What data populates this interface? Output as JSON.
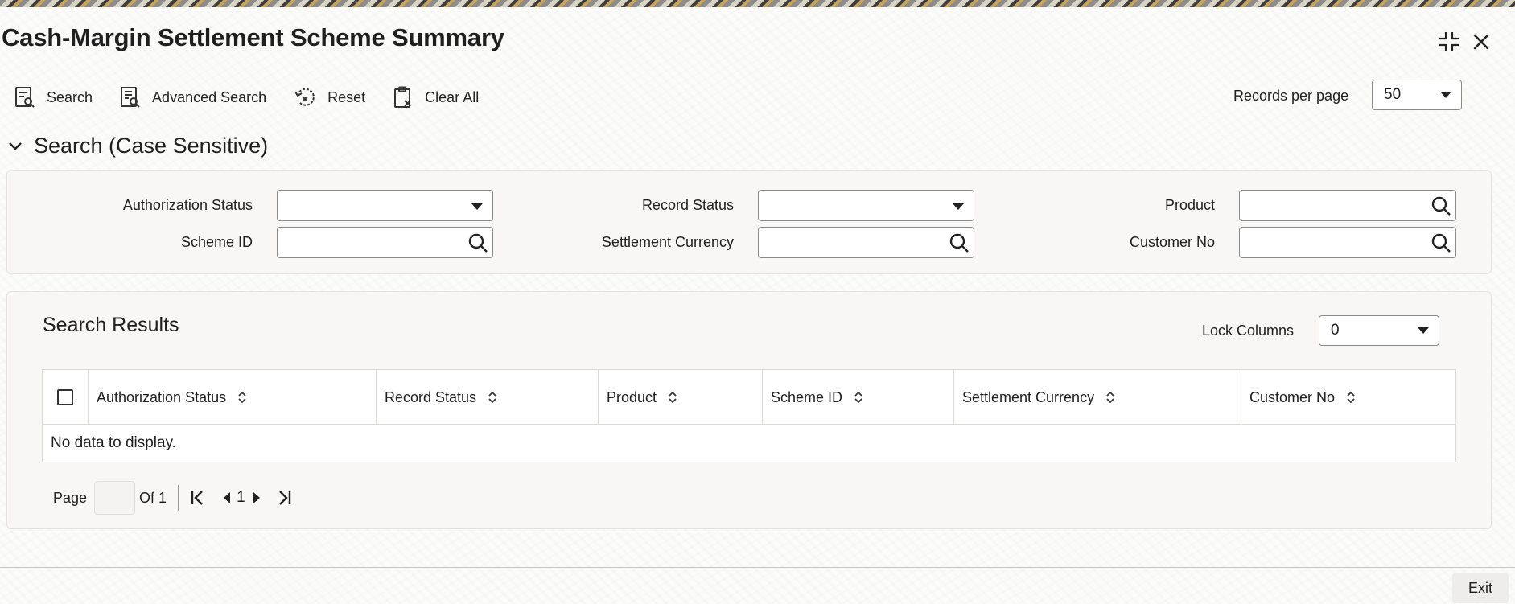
{
  "window": {
    "title": "Cash-Margin Settlement Scheme Summary"
  },
  "toolbar": {
    "search_label": "Search",
    "advanced_search_label": "Advanced Search",
    "reset_label": "Reset",
    "clear_all_label": "Clear All",
    "records_per_page_label": "Records per page",
    "records_per_page_value": "50"
  },
  "search_section": {
    "title": "Search (Case Sensitive)",
    "fields": {
      "authorization_status": {
        "label": "Authorization Status",
        "value": ""
      },
      "record_status": {
        "label": "Record Status",
        "value": ""
      },
      "product": {
        "label": "Product",
        "value": ""
      },
      "scheme_id": {
        "label": "Scheme ID",
        "value": ""
      },
      "settlement_currency": {
        "label": "Settlement Currency",
        "value": ""
      },
      "customer_no": {
        "label": "Customer No",
        "value": ""
      }
    }
  },
  "results": {
    "title": "Search Results",
    "lock_columns_label": "Lock Columns",
    "lock_columns_value": "0",
    "columns": [
      "Authorization Status",
      "Record Status",
      "Product",
      "Scheme ID",
      "Settlement Currency",
      "Customer No"
    ],
    "rows": [],
    "empty_message": "No data to display."
  },
  "pagination": {
    "page_label": "Page",
    "page_value": "",
    "of_label": "Of 1",
    "current_page": "1"
  },
  "footer": {
    "exit_label": "Exit"
  }
}
